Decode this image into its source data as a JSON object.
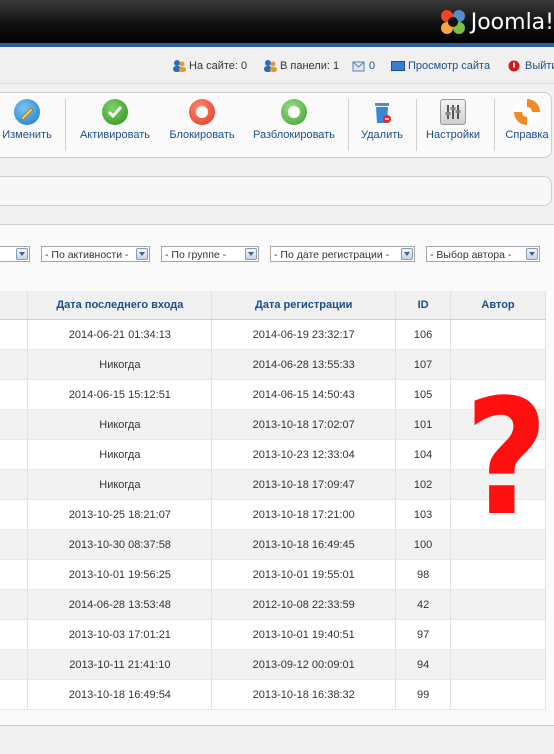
{
  "header": {
    "logo_text": "Joomla!"
  },
  "status": {
    "online_site": "На сайте: 0",
    "online_admin": "В панели: 1",
    "messages": "0",
    "view_site": "Просмотр сайта",
    "logout": "Выйти"
  },
  "toolbar": {
    "edit": "Изменить",
    "activate": "Активировать",
    "block": "Блокировать",
    "unblock": "Разблокировать",
    "delete": "Удалить",
    "settings": "Настройки",
    "help": "Справка"
  },
  "filters": {
    "first": "",
    "activity": "- По активности -",
    "group": "- По группе -",
    "reg_date": "- По дате регистрации -",
    "author": "- Выбор автора -"
  },
  "table": {
    "headers": [
      "",
      "Дата последнего входа",
      "Дата регистрации",
      "ID",
      "Автор"
    ],
    "rows": [
      [
        "2014-06-21 01:34:13",
        "2014-06-19 23:32:17",
        "106"
      ],
      [
        "Никогда",
        "2014-06-28 13:55:33",
        "107"
      ],
      [
        "2014-06-15 15:12:51",
        "2014-06-15 14:50:43",
        "105"
      ],
      [
        "Никогда",
        "2013-10-18 17:02:07",
        "101"
      ],
      [
        "Никогда",
        "2013-10-23 12:33:04",
        "104"
      ],
      [
        "Никогда",
        "2013-10-18 17:09:47",
        "102"
      ],
      [
        "2013-10-25 18:21:07",
        "2013-10-18 17:21:00",
        "103"
      ],
      [
        "2013-10-30 08:37:58",
        "2013-10-18 16:49:45",
        "100"
      ],
      [
        "2013-10-01 19:56:25",
        "2013-10-01 19:55:01",
        "98"
      ],
      [
        "2014-06-28 13:53:48",
        "2012-10-08 22:33:59",
        "42"
      ],
      [
        "2013-10-03 17:01:21",
        "2013-10-01 19:40:51",
        "97"
      ],
      [
        "2013-10-11 21:41:10",
        "2013-09-12 00:09:01",
        "94"
      ],
      [
        "2013-10-18 16:49:54",
        "2013-10-18 16:38:32",
        "99"
      ]
    ]
  },
  "annotation": {
    "mark": "?"
  }
}
